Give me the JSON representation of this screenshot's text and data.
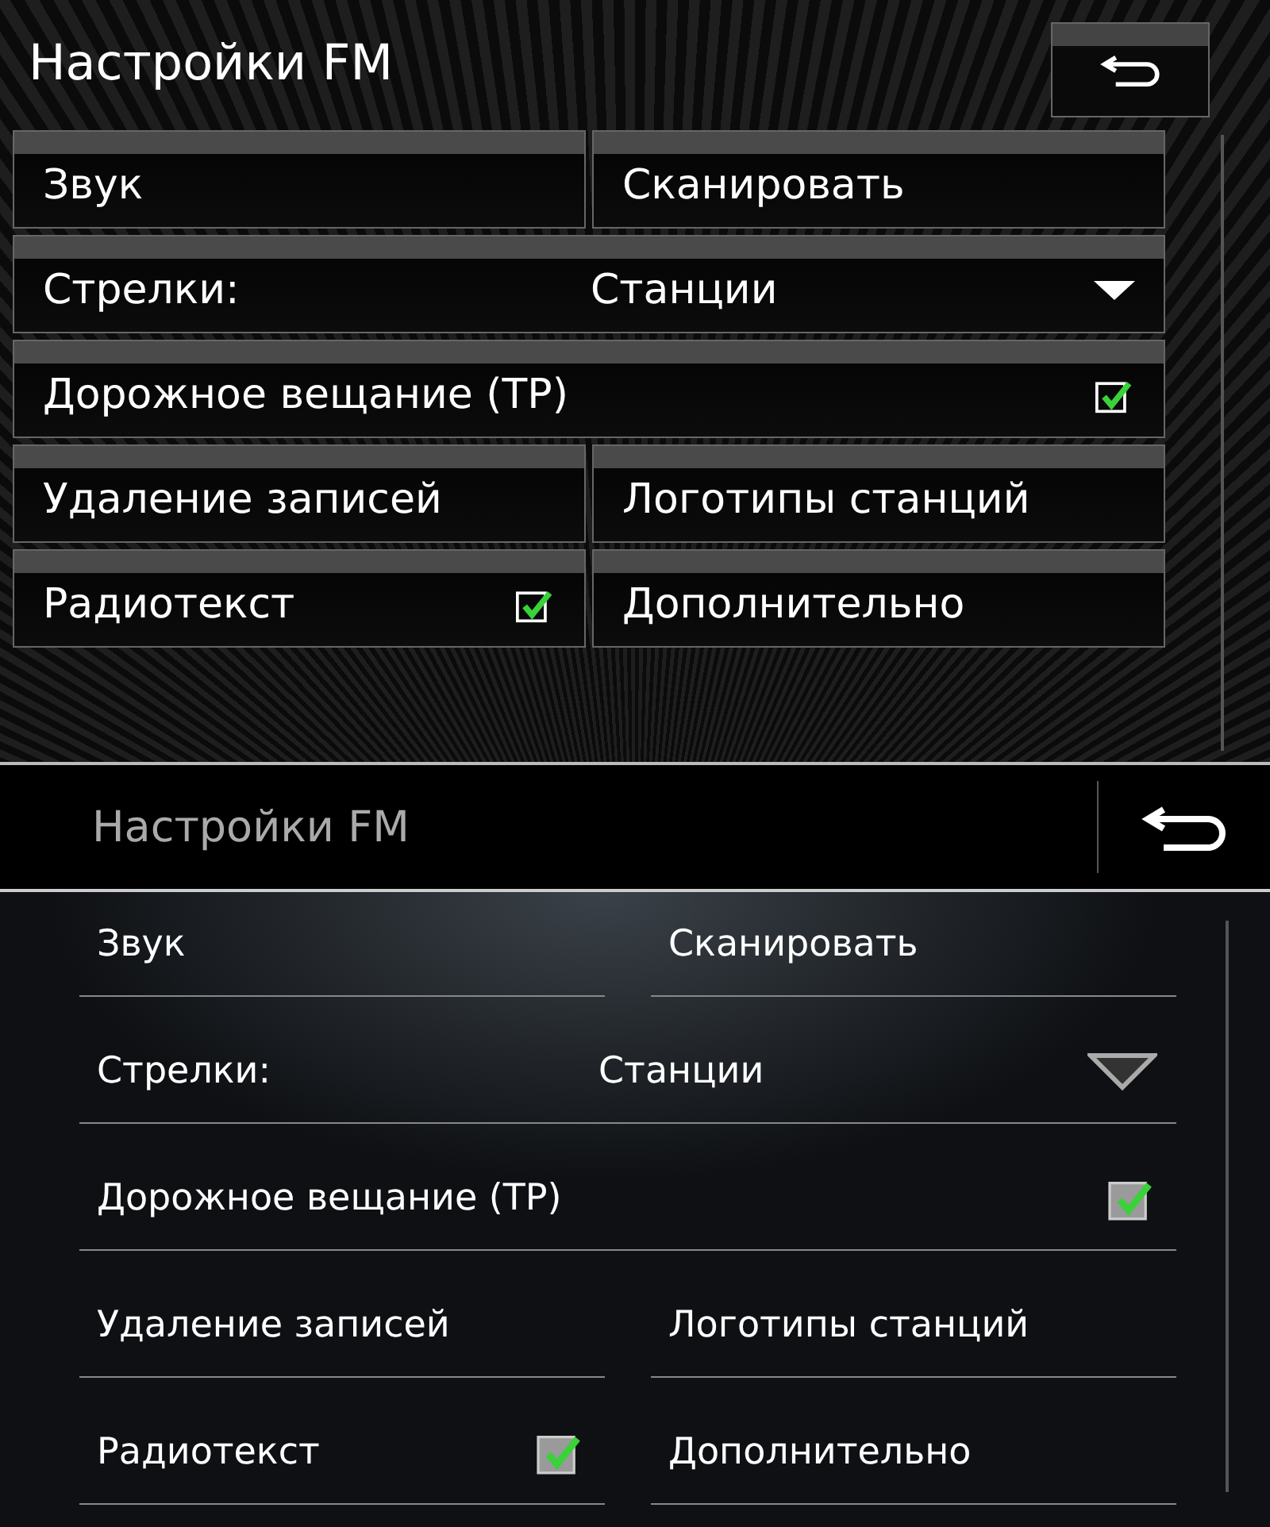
{
  "screens": [
    {
      "kind": "classic",
      "title": "Настройки FM",
      "rows": [
        {
          "cells": [
            {
              "kind": "button",
              "label": "Звук"
            },
            {
              "kind": "button",
              "label": "Сканировать"
            }
          ]
        },
        {
          "cells": [
            {
              "kind": "select",
              "label": "Стрелки:",
              "value": "Станции"
            }
          ]
        },
        {
          "cells": [
            {
              "kind": "toggle",
              "label": "Дорожное вещание (TP)",
              "checked": true
            }
          ]
        },
        {
          "cells": [
            {
              "kind": "button",
              "label": "Удаление записей"
            },
            {
              "kind": "button",
              "label": "Логотипы станций"
            }
          ]
        },
        {
          "cells": [
            {
              "kind": "toggle",
              "label": "Радиотекст",
              "checked": true
            },
            {
              "kind": "button",
              "label": "Дополнительно"
            }
          ]
        }
      ]
    },
    {
      "kind": "modern",
      "title": "Настройки FM",
      "rows": [
        {
          "cells": [
            {
              "kind": "button",
              "label": "Звук"
            },
            {
              "kind": "button",
              "label": "Сканировать"
            }
          ]
        },
        {
          "cells": [
            {
              "kind": "select",
              "label": "Стрелки:",
              "value": "Станции"
            }
          ]
        },
        {
          "cells": [
            {
              "kind": "toggle",
              "label": "Дорожное вещание (TP)",
              "checked": true
            }
          ]
        },
        {
          "cells": [
            {
              "kind": "button",
              "label": "Удаление записей"
            },
            {
              "kind": "button",
              "label": "Логотипы станций"
            }
          ]
        },
        {
          "cells": [
            {
              "kind": "toggle",
              "label": "Радиотекст",
              "checked": true
            },
            {
              "kind": "button",
              "label": "Дополнительно"
            }
          ]
        }
      ]
    }
  ]
}
